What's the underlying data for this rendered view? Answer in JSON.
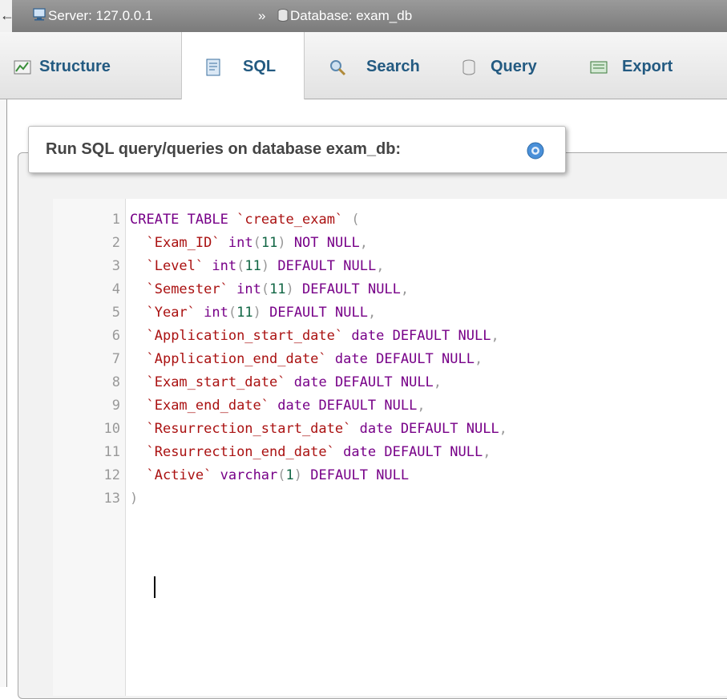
{
  "breadcrumb": {
    "back": "←",
    "server_label": "Server: 127.0.0.1",
    "separator": "»",
    "database_label": "Database: exam_db"
  },
  "tabs": [
    {
      "label": "Structure",
      "icon": "structure-icon"
    },
    {
      "label": "SQL",
      "icon": "sql-icon",
      "active": true
    },
    {
      "label": "Search",
      "icon": "search-icon"
    },
    {
      "label": "Query",
      "icon": "query-icon"
    },
    {
      "label": "Export",
      "icon": "export-icon"
    }
  ],
  "panel": {
    "legend": "Run SQL query/queries on database exam_db:",
    "help_icon": "help-icon"
  },
  "editor": {
    "lines": [
      {
        "n": "1",
        "text": "CREATE TABLE `create_exam` ("
      },
      {
        "n": "2",
        "text": "  `Exam_ID` int(11) NOT NULL,"
      },
      {
        "n": "3",
        "text": "  `Level` int(11) DEFAULT NULL,"
      },
      {
        "n": "4",
        "text": "  `Semester` int(11) DEFAULT NULL,"
      },
      {
        "n": "5",
        "text": "  `Year` int(11) DEFAULT NULL,"
      },
      {
        "n": "6",
        "text": "  `Application_start_date` date DEFAULT NULL,"
      },
      {
        "n": "7",
        "text": "  `Application_end_date` date DEFAULT NULL,"
      },
      {
        "n": "8",
        "text": "  `Exam_start_date` date DEFAULT NULL,"
      },
      {
        "n": "9",
        "text": "  `Exam_end_date` date DEFAULT NULL,"
      },
      {
        "n": "10",
        "text": "  `Resurrection_start_date` date DEFAULT NULL,"
      },
      {
        "n": "11",
        "text": "  `Resurrection_end_date` date DEFAULT NULL,"
      },
      {
        "n": "12",
        "text": "  `Active` varchar(1) DEFAULT NULL"
      },
      {
        "n": "13",
        "text": ")"
      }
    ]
  },
  "colors": {
    "keyword": "#770088",
    "identifier": "#aa1111",
    "number": "#116644",
    "tab_text": "#235a81"
  }
}
